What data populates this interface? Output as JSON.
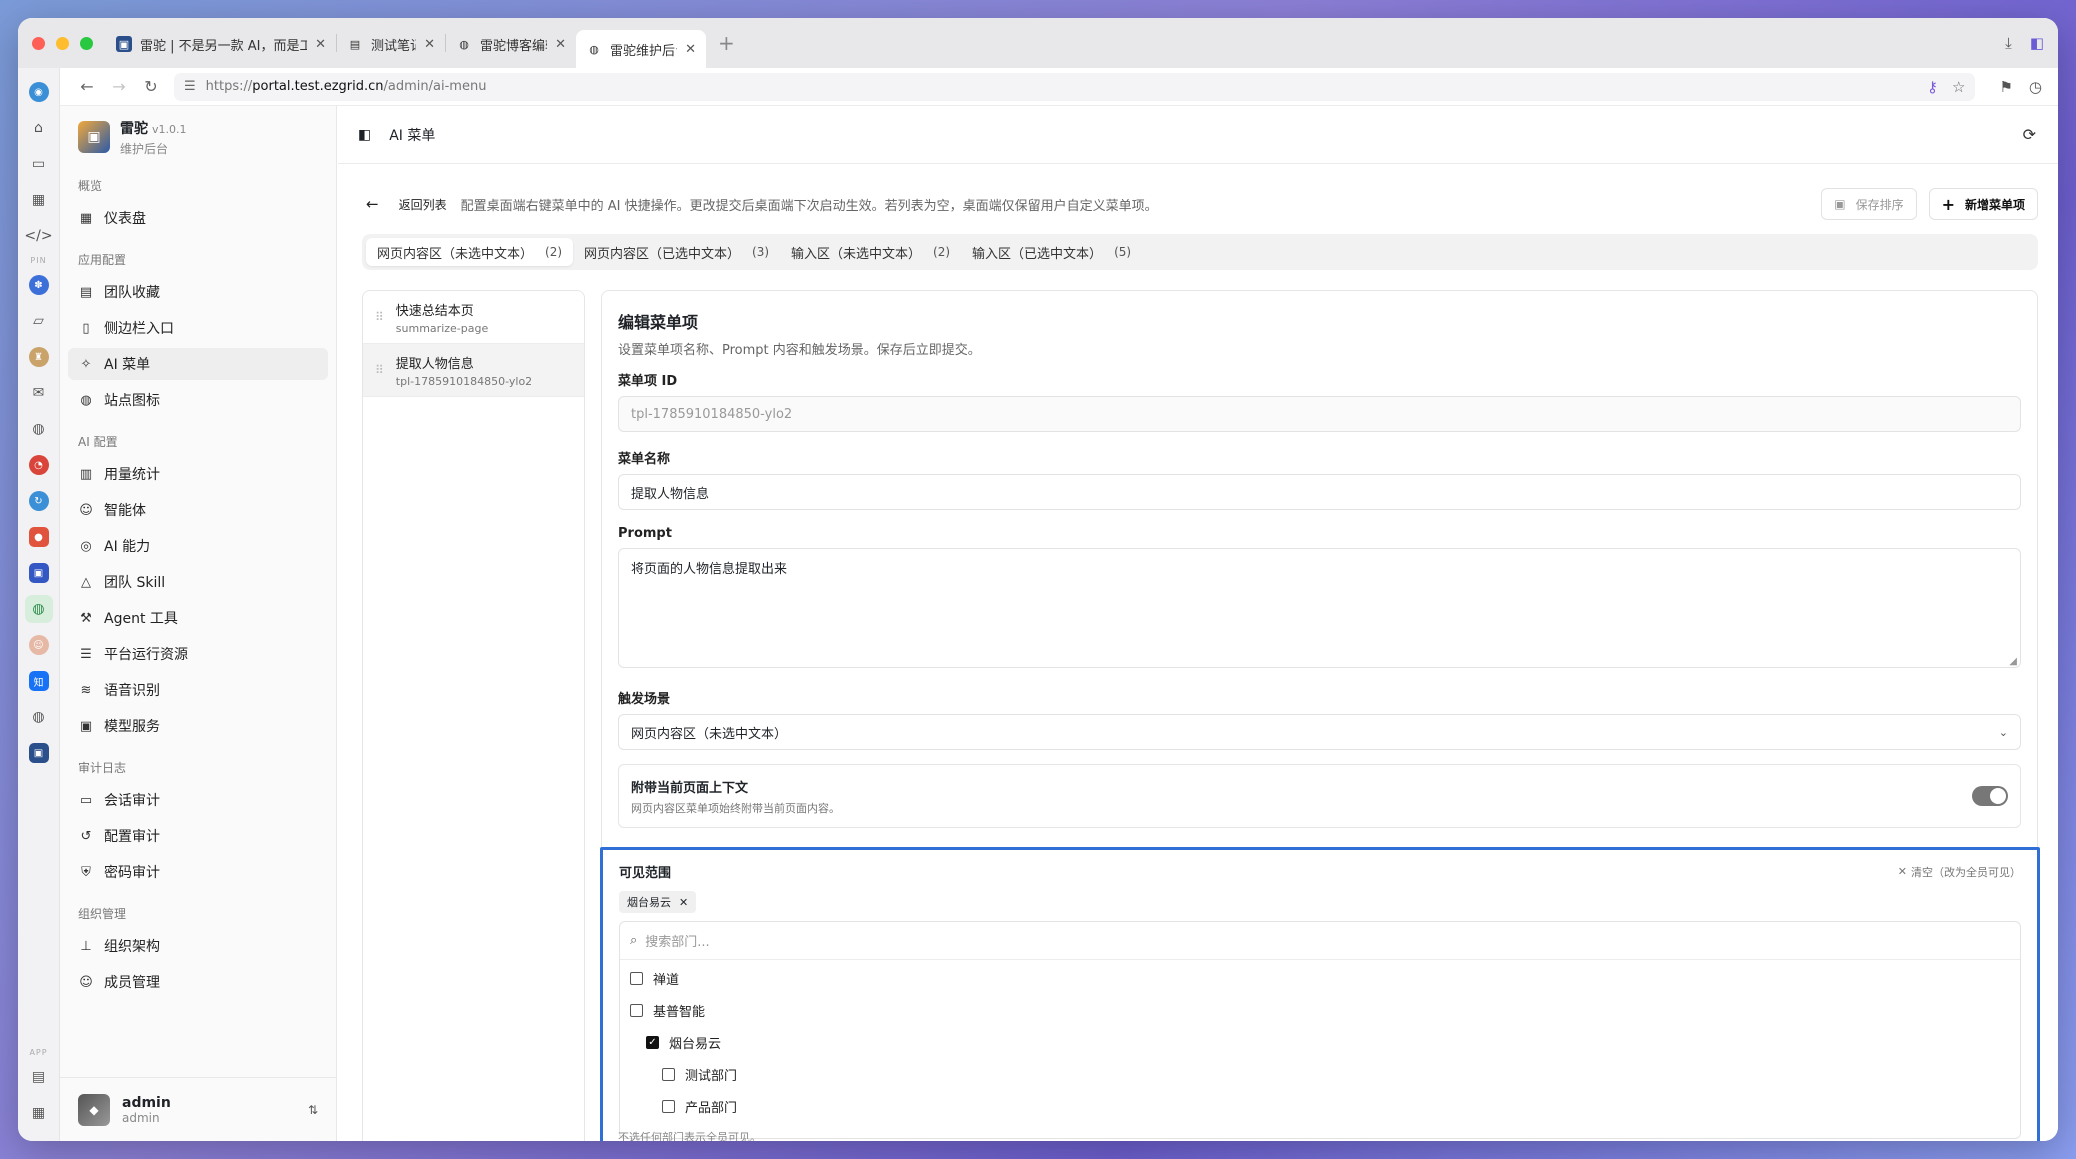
{
  "browser": {
    "tabs": [
      {
        "title": "雷驼 | 不是另一款 AI，而是工作…",
        "favicon": "leitou-icon"
      },
      {
        "title": "测试笔记",
        "favicon": "doc-icon"
      },
      {
        "title": "雷驼博客编辑",
        "favicon": "globe-icon"
      },
      {
        "title": "雷驼维护后台",
        "favicon": "globe-icon"
      }
    ],
    "url": {
      "scheme": "https://",
      "host": "portal.test.ezgrid.cn",
      "path": "/admin/ai-menu"
    },
    "strip_labels": {
      "pin": "PIN",
      "app": "APP"
    }
  },
  "brand": {
    "name": "雷驼",
    "version": "v1.0.1",
    "subtitle": "维护后台"
  },
  "sidebar": {
    "groups": [
      {
        "label": "概览",
        "items": [
          {
            "label": "仪表盘",
            "icon": "dashboard-icon"
          }
        ]
      },
      {
        "label": "应用配置",
        "items": [
          {
            "label": "团队收藏",
            "icon": "bookmark-icon"
          },
          {
            "label": "侧边栏入口",
            "icon": "sidebar-icon"
          },
          {
            "label": "AI 菜单",
            "icon": "sparkle-icon"
          },
          {
            "label": "站点图标",
            "icon": "globe-icon"
          }
        ]
      },
      {
        "label": "AI 配置",
        "items": [
          {
            "label": "用量统计",
            "icon": "bar-chart-icon"
          },
          {
            "label": "智能体",
            "icon": "bot-icon"
          },
          {
            "label": "AI 能力",
            "icon": "ai-icon"
          },
          {
            "label": "团队 Skill",
            "icon": "graduation-icon"
          },
          {
            "label": "Agent 工具",
            "icon": "tools-icon"
          },
          {
            "label": "平台运行资源",
            "icon": "database-icon"
          },
          {
            "label": "语音识别",
            "icon": "waveform-icon"
          },
          {
            "label": "模型服务",
            "icon": "chip-icon"
          }
        ]
      },
      {
        "label": "审计日志",
        "items": [
          {
            "label": "会话审计",
            "icon": "chat-icon"
          },
          {
            "label": "配置审计",
            "icon": "history-icon"
          },
          {
            "label": "密码审计",
            "icon": "shield-icon"
          }
        ]
      },
      {
        "label": "组织管理",
        "items": [
          {
            "label": "组织架构",
            "icon": "org-icon"
          },
          {
            "label": "成员管理",
            "icon": "users-icon"
          }
        ]
      }
    ],
    "user": {
      "name": "admin",
      "role": "admin"
    }
  },
  "header": {
    "title": "AI 菜单"
  },
  "toolbar": {
    "back_label": "返回列表",
    "description": "配置桌面端右键菜单中的 AI 快捷操作。更改提交后桌面端下次启动生效。若列表为空，桌面端仅保留用户自定义菜单项。",
    "save_order_label": "保存排序",
    "add_item_label": "新增菜单项"
  },
  "segments": [
    {
      "label": "网页内容区（未选中文本）",
      "count": "(2)"
    },
    {
      "label": "网页内容区（已选中文本）",
      "count": "(3)"
    },
    {
      "label": "输入区（未选中文本）",
      "count": "(2)"
    },
    {
      "label": "输入区（已选中文本）",
      "count": "(5)"
    }
  ],
  "menu_items": [
    {
      "title": "快速总结本页",
      "id": "summarize-page"
    },
    {
      "title": "提取人物信息",
      "id": "tpl-1785910184850-ylo2"
    }
  ],
  "editor": {
    "title": "编辑菜单项",
    "description": "设置菜单项名称、Prompt 内容和触发场景。保存后立即提交。",
    "id_label": "菜单项 ID",
    "id_value": "tpl-1785910184850-ylo2",
    "name_label": "菜单名称",
    "name_value": "提取人物信息",
    "prompt_label": "Prompt",
    "prompt_value": "将页面的人物信息提取出来",
    "trigger_label": "触发场景",
    "trigger_value": "网页内容区（未选中文本）",
    "context_title": "附带当前页面上下文",
    "context_desc": "网页内容区菜单项始终附带当前页面内容。",
    "context_enabled": true
  },
  "scope": {
    "title": "可见范围",
    "clear_label": "清空（改为全员可见）",
    "selected_chip": "烟台易云",
    "search_placeholder": "搜索部门...",
    "tree": [
      {
        "label": "禅道",
        "checked": false,
        "level": 0
      },
      {
        "label": "基普智能",
        "checked": false,
        "level": 0
      },
      {
        "label": "烟台易云",
        "checked": true,
        "level": 1
      },
      {
        "label": "测试部门",
        "checked": false,
        "level": 2
      },
      {
        "label": "产品部门",
        "checked": false,
        "level": 2
      }
    ],
    "footnote": "不选任何部门表示全员可见。",
    "highlight_color": "#2f6fd6"
  }
}
